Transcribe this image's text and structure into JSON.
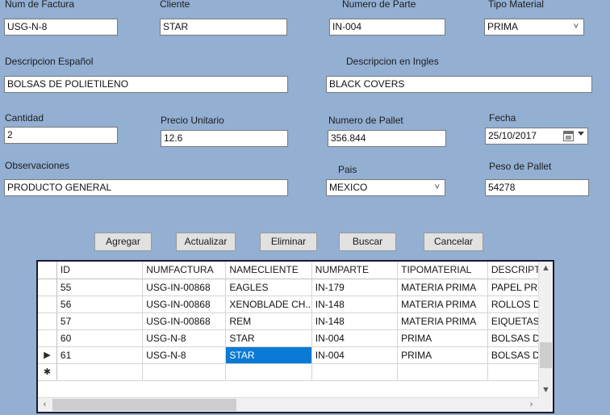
{
  "theme": {
    "background": "#93afd2",
    "field_bg": "#ffffff",
    "field_border": "#7a7a7a",
    "button_bg": "#e1e1e1",
    "selection_blue": "#0a7ad4",
    "grid_border": "#1b1b30"
  },
  "fields": {
    "num_factura": {
      "label": "Num de Factura",
      "value": "USG-N-8"
    },
    "cliente": {
      "label": "Cliente",
      "value": "STAR"
    },
    "numero_parte": {
      "label": "Numero de Parte",
      "value": "IN-004"
    },
    "tipo_material": {
      "label": "Tipo Material",
      "value": "PRIMA",
      "chevron": "chevron-down-icon"
    },
    "descripcion_espanol": {
      "label": "Descripcion Español",
      "value": "BOLSAS DE POLIETILENO"
    },
    "descripcion_ingles": {
      "label": "Descripcion en Ingles",
      "value": "BLACK COVERS"
    },
    "cantidad": {
      "label": "Cantidad",
      "value": "2"
    },
    "precio_unitario": {
      "label": "Precio Unitario",
      "value": "12.6"
    },
    "numero_pallet": {
      "label": "Numero de Pallet",
      "value": "356.844"
    },
    "fecha": {
      "label": "Fecha",
      "value": "25/10/2017",
      "icon": "calendar-icon",
      "chevron": "chevron-down-icon"
    },
    "observaciones": {
      "label": "Observaciones",
      "value": "PRODUCTO GENERAL"
    },
    "pais": {
      "label": "Pais",
      "value": "MEXICO",
      "chevron": "chevron-down-icon"
    },
    "peso_pallet": {
      "label": "Peso de Pallet",
      "value": "54278"
    }
  },
  "buttons": {
    "agregar": "Agregar",
    "actualizar": "Actualizar",
    "eliminar": "Eliminar",
    "buscar": "Buscar",
    "cancelar": "Cancelar"
  },
  "grid": {
    "columns": [
      "ID",
      "NUMFACTURA",
      "NAMECLIENTE",
      "NUMPARTE",
      "TIPOMATERIAL",
      "DESCRIPTION"
    ],
    "rows": [
      {
        "indicator": "",
        "id": "55",
        "numfactura": "USG-IN-00868",
        "namecliente": "EAGLES",
        "numparte": "IN-179",
        "tipomaterial": "MATERIA PRIMA",
        "description": "PAPEL PRECORTADO",
        "selected_cell": ""
      },
      {
        "indicator": "",
        "id": "56",
        "numfactura": "USG-IN-00868",
        "namecliente": "XENOBLADE CH...",
        "numparte": "IN-148",
        "tipomaterial": "MATERIA PRIMA",
        "description": "ROLLOS DE CINTA",
        "selected_cell": ""
      },
      {
        "indicator": "",
        "id": "57",
        "numfactura": "USG-IN-00868",
        "namecliente": "REM",
        "numparte": "IN-148",
        "tipomaterial": "MATERIA PRIMA",
        "description": "EIQUETAS DE IDENTIFICACION",
        "selected_cell": ""
      },
      {
        "indicator": "",
        "id": "60",
        "numfactura": "USG-N-8",
        "namecliente": "STAR",
        "numparte": "IN-004",
        "tipomaterial": "PRIMA",
        "description": "BOLSAS DE POLIETILENO",
        "selected_cell": ""
      },
      {
        "indicator": "▶",
        "id": "61",
        "numfactura": "USG-N-8",
        "namecliente": "STAR",
        "numparte": "IN-004",
        "tipomaterial": "PRIMA",
        "description": "BOLSAS DE POLIETILENO",
        "selected_cell": "namecliente"
      },
      {
        "indicator": "✱",
        "id": "",
        "numfactura": "",
        "namecliente": "",
        "numparte": "",
        "tipomaterial": "",
        "description": "",
        "selected_cell": ""
      }
    ],
    "scrollbar": {
      "up_arrow": "▲",
      "down_arrow": "▼",
      "left_arrow": "‹",
      "right_arrow": "›"
    }
  }
}
